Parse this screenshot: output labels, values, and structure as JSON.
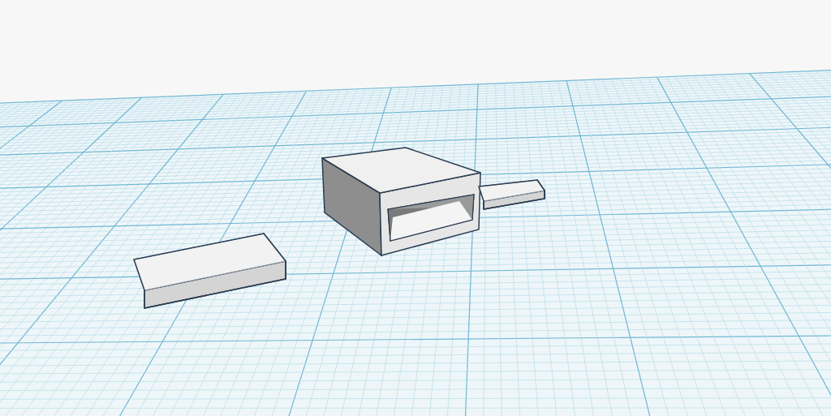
{
  "workplane": {
    "grid": true
  },
  "shapes": [
    {
      "kind": "slab"
    },
    {
      "kind": "hollow-box"
    },
    {
      "kind": "slab"
    }
  ]
}
